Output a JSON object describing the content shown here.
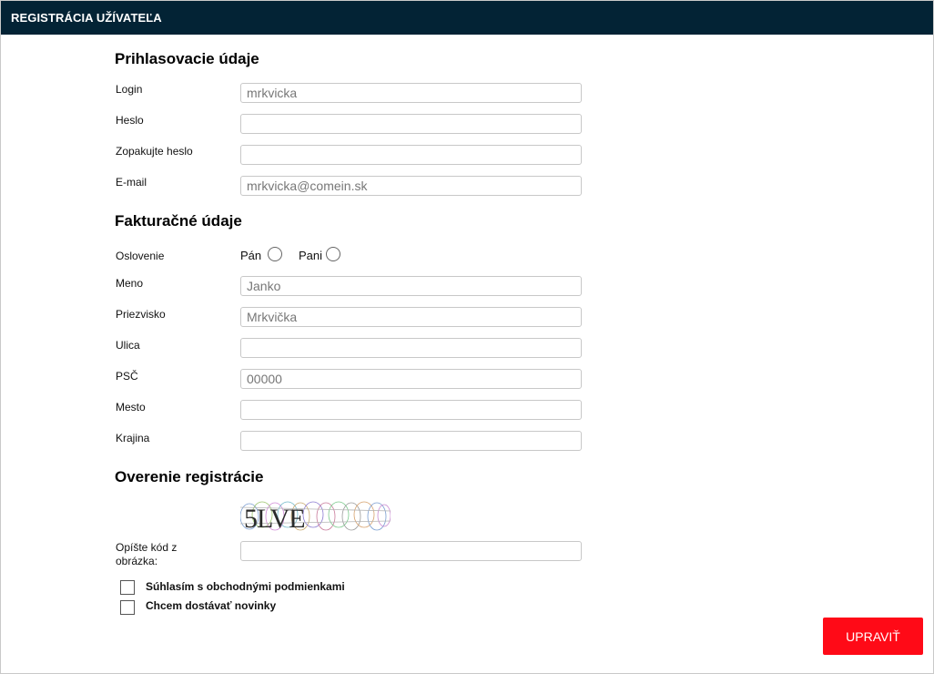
{
  "header": {
    "title": "REGISTRÁCIA UŽÍVATEĽA"
  },
  "login_section": {
    "title": "Prihlasovacie údaje",
    "login_label": "Login",
    "login_placeholder": "mrkvicka",
    "password_label": "Heslo",
    "password_confirm_label": "Zopakujte heslo",
    "email_label": "E-mail",
    "email_placeholder": "mrkvicka@comein.sk"
  },
  "billing_section": {
    "title": "Fakturačné údaje",
    "salutation_label": "Oslovenie",
    "salutation_options": [
      "Pán",
      "Pani"
    ],
    "first_name_label": "Meno",
    "first_name_placeholder": "Janko",
    "last_name_label": "Priezvisko",
    "last_name_placeholder": "Mrkvička",
    "street_label": "Ulica",
    "zip_label": "PSČ",
    "zip_placeholder": "00000",
    "city_label": "Mesto",
    "country_label": "Krajina"
  },
  "verification_section": {
    "title": "Overenie registrácie",
    "captcha_text": "5LVE",
    "captcha_input_label": "Opíšte kód z obrázka:"
  },
  "agreements": {
    "terms_label": "Súhlasím s obchodnými podmienkami",
    "newsletter_label": "Chcem dostávať novinky"
  },
  "actions": {
    "submit_label": "UPRAVIŤ"
  },
  "colors": {
    "header_bg": "#032335",
    "button_bg": "#ff0a17"
  }
}
